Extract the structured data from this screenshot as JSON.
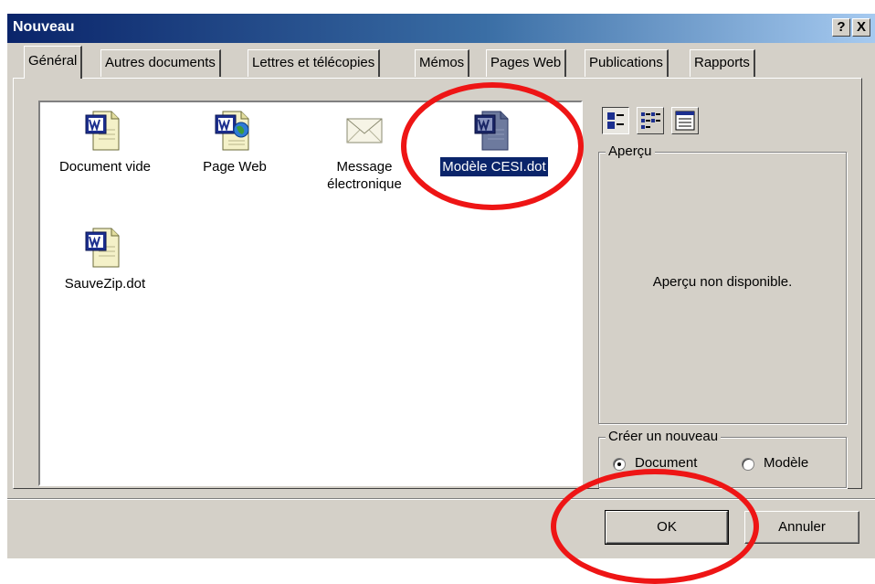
{
  "window": {
    "title": "Nouveau",
    "help_label": "?",
    "close_label": "X"
  },
  "tabs": [
    {
      "label": "Général",
      "active": true
    },
    {
      "label": "Autres documents"
    },
    {
      "label": "Lettres et télécopies"
    },
    {
      "label": "Mémos"
    },
    {
      "label": "Pages Web"
    },
    {
      "label": "Publications"
    },
    {
      "label": "Rapports"
    }
  ],
  "templates": [
    {
      "label": "Document vide",
      "icon": "word-document-icon"
    },
    {
      "label": "Page Web",
      "icon": "word-web-page-icon"
    },
    {
      "label": "Message électronique",
      "label_line1": "Message",
      "label_line2": "électronique",
      "icon": "envelope-icon"
    },
    {
      "label": "Modèle CESI.dot",
      "icon": "word-template-icon",
      "selected": true
    },
    {
      "label": "SauveZip.dot",
      "icon": "word-document-icon"
    }
  ],
  "view_buttons": [
    {
      "icon": "large-icons-view-icon",
      "pressed": true
    },
    {
      "icon": "list-view-icon"
    },
    {
      "icon": "details-view-icon"
    }
  ],
  "preview": {
    "legend": "Aperçu",
    "message": "Aperçu non disponible."
  },
  "create_new": {
    "legend": "Créer un nouveau",
    "option_document": "Document",
    "option_model": "Modèle",
    "selected": "Document"
  },
  "buttons": {
    "ok": "OK",
    "cancel": "Annuler"
  },
  "colors": {
    "annotation": "#ee1515",
    "selection": "#0a246a",
    "titlebar_start": "#0a246a"
  }
}
